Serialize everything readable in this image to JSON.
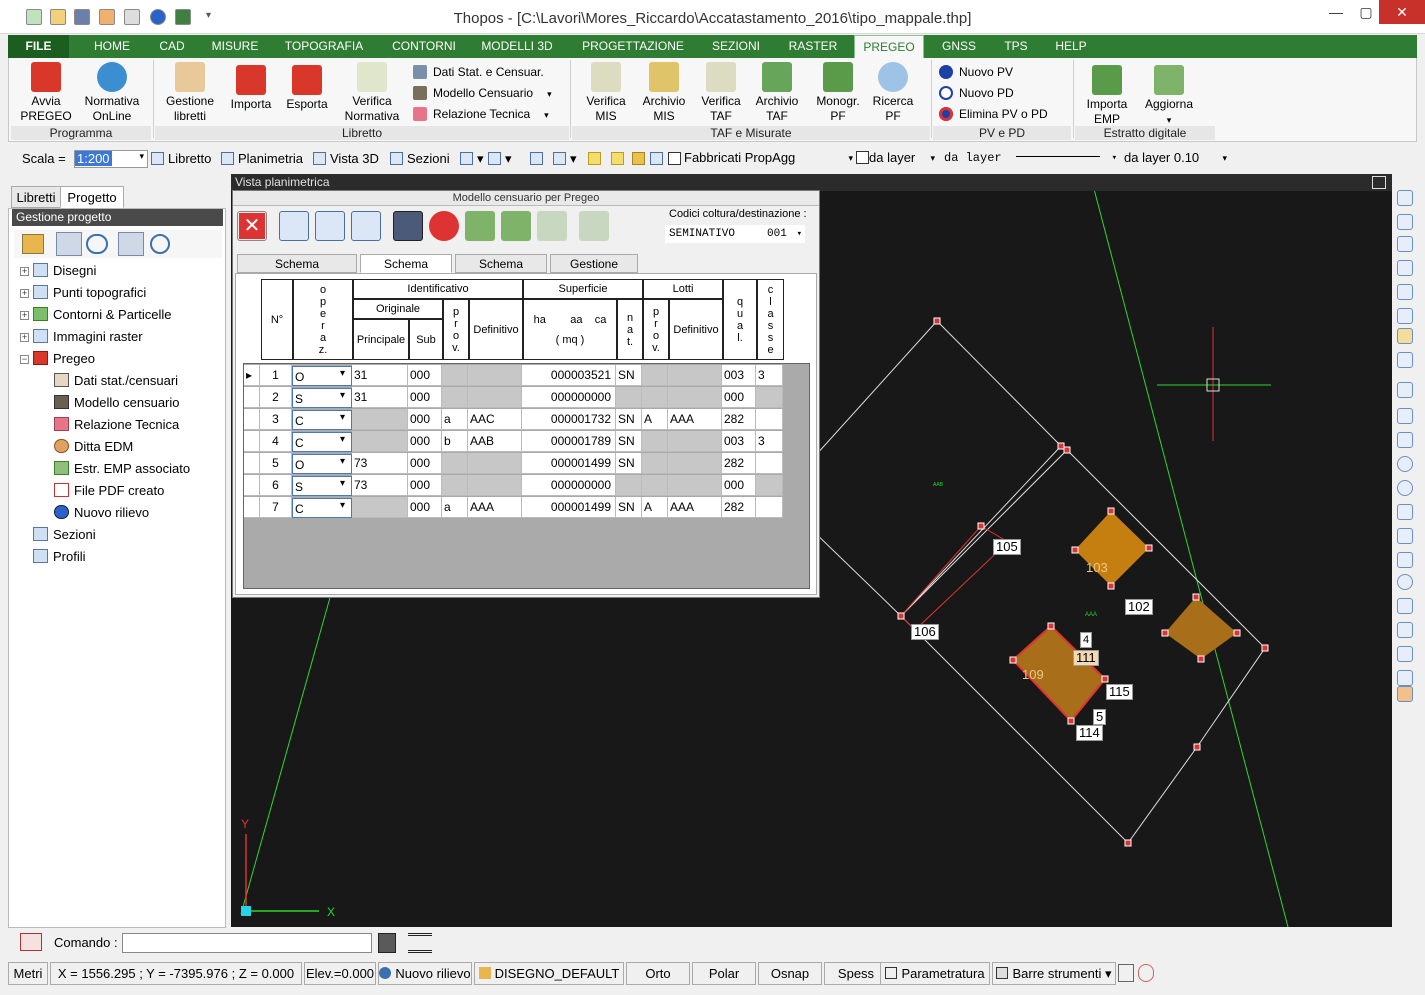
{
  "window": {
    "title": "Thopos - [C:\\Lavori\\Mores_Riccardo\\Accatastamento_2016\\tipo_mappale.thp]",
    "minimize": "—",
    "maximize": "▢",
    "close": "✕"
  },
  "menu": {
    "file": "FILE",
    "items": [
      "HOME",
      "CAD",
      "MISURE",
      "TOPOGRAFIA",
      "CONTORNI",
      "MODELLI 3D",
      "PROGETTAZIONE",
      "SEZIONI",
      "RASTER",
      "PREGEO",
      "GNSS",
      "TPS",
      "HELP"
    ]
  },
  "ribbon": {
    "avvia": [
      "Avvia",
      "PREGEO"
    ],
    "normativa": [
      "Normativa",
      "OnLine"
    ],
    "gestione": [
      "Gestione",
      "libretti"
    ],
    "importa": "Importa",
    "esporta": "Esporta",
    "verifica": [
      "Verifica",
      "Normativa"
    ],
    "small1": [
      "Dati Stat. e Censuar.",
      "Modello Censuario",
      "Relazione Tecnica"
    ],
    "vmis": [
      "Verifica",
      "MIS"
    ],
    "amis": [
      "Archivio",
      "MIS"
    ],
    "vtaf": [
      "Verifica",
      "TAF"
    ],
    "ataf": [
      "Archivio",
      "TAF"
    ],
    "mono": [
      "Monogr.",
      "PF"
    ],
    "ricerca": [
      "Ricerca",
      "PF"
    ],
    "small2": [
      "Nuovo PV",
      "Nuovo PD",
      "Elimina PV o PD"
    ],
    "iemp": [
      "Importa",
      "EMP"
    ],
    "aggiorna": "Aggiorna",
    "groups": [
      "Programma",
      "Libretto",
      "TAF e Misurate",
      "PV e PD",
      "Estratto digitale"
    ]
  },
  "toolbar2": {
    "scala_label": "Scala =",
    "scala_value": "1:200",
    "libretto": "Libretto",
    "planimetria": "Planimetria",
    "vista3d": "Vista 3D",
    "sezioni": "Sezioni",
    "fabbricati": "Fabbricati PropAgg",
    "dalayer1": "da layer",
    "dalayer2": "da layer",
    "dalayer3": "da layer 0.10"
  },
  "left": {
    "tabs": [
      "Libretti",
      "Progetto"
    ],
    "header": "Gestione progetto",
    "tree": [
      "Disegni",
      "Punti topografici",
      "Contorni & Particelle",
      "Immagini raster",
      "Pregeo",
      "Dati stat./censuari",
      "Modello censuario",
      "Relazione Tecnica",
      "Ditta EDM",
      "Estr. EMP associato",
      "File PDF creato",
      "Nuovo rilievo",
      "Sezioni",
      "Profili"
    ]
  },
  "viewport": {
    "title": "Vista planimetrica",
    "axis_x": "X",
    "axis_y": "Y",
    "labels": [
      "105",
      "103",
      "102",
      "106",
      "109",
      "111",
      "115",
      "5",
      "114",
      "4"
    ],
    "tiny": [
      "AAB",
      "AAA"
    ]
  },
  "dialog": {
    "title": "Modello censuario per Pregeo",
    "codici_label": "Codici coltura/destinazione :",
    "codici_value": "SEMINATIVO",
    "codici_code": "001",
    "tabs": [
      "Schema Frazionamento",
      "Schema Mappale",
      "Schema Ausiliario",
      "Gestione Schemi"
    ],
    "headers": {
      "n": "N°",
      "operaz": "o p e r a z.",
      "identificativo": "Identificativo",
      "originale": "Originale",
      "principale": "Principale",
      "sub": "Sub",
      "prov": "p r o v.",
      "definitivo": "Definitivo",
      "superficie": "Superficie",
      "ha_aa_ca": "ha        aa    ca",
      "mq": "( mq )",
      "nat": "n a t.",
      "lotti": "Lotti",
      "prov2": "p r o v.",
      "definitivo2": "Definitivo",
      "qual": "q u a l.",
      "classe": "c l a s s e"
    },
    "rows": [
      {
        "n": "1",
        "op": "O",
        "princ": "31",
        "sub": "000",
        "prov": "",
        "def": "",
        "sup": "000003521",
        "nat": "SN",
        "lprov": "",
        "ldef": "",
        "qual": "003",
        "cls": "3"
      },
      {
        "n": "2",
        "op": "S",
        "princ": "31",
        "sub": "000",
        "prov": "",
        "def": "",
        "sup": "000000000",
        "nat": "",
        "lprov": "",
        "ldef": "",
        "qual": "000",
        "cls": ""
      },
      {
        "n": "3",
        "op": "C",
        "princ": "",
        "sub": "000",
        "prov": "a",
        "def": "AAC",
        "sup": "000001732",
        "nat": "SN",
        "lprov": "A",
        "ldef": "AAA",
        "qual": "282",
        "cls": ""
      },
      {
        "n": "4",
        "op": "C",
        "princ": "",
        "sub": "000",
        "prov": "b",
        "def": "AAB",
        "sup": "000001789",
        "nat": "SN",
        "lprov": "",
        "ldef": "",
        "qual": "003",
        "cls": "3"
      },
      {
        "n": "5",
        "op": "O",
        "princ": "73",
        "sub": "000",
        "prov": "",
        "def": "",
        "sup": "000001499",
        "nat": "SN",
        "lprov": "",
        "ldef": "",
        "qual": "282",
        "cls": ""
      },
      {
        "n": "6",
        "op": "S",
        "princ": "73",
        "sub": "000",
        "prov": "",
        "def": "",
        "sup": "000000000",
        "nat": "",
        "lprov": "",
        "ldef": "",
        "qual": "000",
        "cls": ""
      },
      {
        "n": "7",
        "op": "C",
        "princ": "",
        "sub": "000",
        "prov": "a",
        "def": "AAA",
        "sup": "000001499",
        "nat": "SN",
        "lprov": "A",
        "ldef": "AAA",
        "qual": "282",
        "cls": ""
      }
    ]
  },
  "command": {
    "label": "Comando :",
    "value": ""
  },
  "status": {
    "metri": "Metri",
    "coords": "X = 1556.295 ; Y = -7395.976 ; Z = 0.000",
    "elev": "Elev.=0.000",
    "nuovo": "Nuovo rilievo",
    "disegno": "DISEGNO_DEFAULT",
    "orto": "Orto",
    "polar": "Polar",
    "osnap": "Osnap",
    "spess": "Spess",
    "param": "Parametratura",
    "barre": "Barre strumenti"
  },
  "colors": {
    "menu_green": "#2e7d32",
    "canvas": "#181818",
    "parcel": "#c47f10"
  }
}
